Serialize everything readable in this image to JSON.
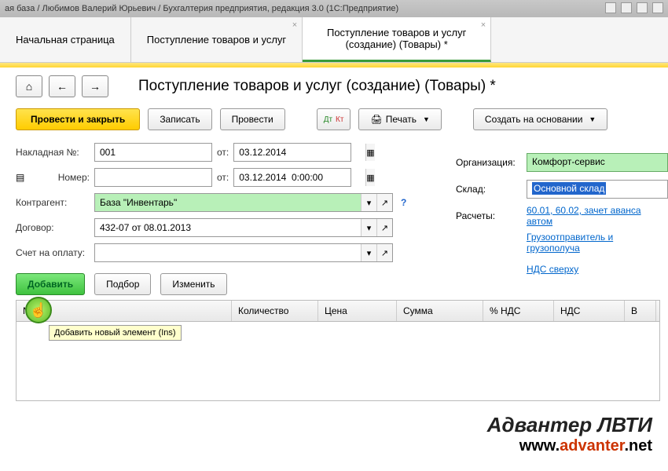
{
  "titlebar": "ая база / Любимов Валерий Юрьевич / Бухгалтерия предприятия, редакция 3.0  (1С:Предприятие)",
  "tabs": [
    {
      "label": "Начальная страница",
      "closable": false
    },
    {
      "label": "Поступление товаров и услуг",
      "closable": true
    },
    {
      "label": "Поступление товаров и услуг (создание) (Товары) *",
      "closable": true
    }
  ],
  "pageTitle": "Поступление товаров и услуг (создание) (Товары) *",
  "actions": {
    "postClose": "Провести и закрыть",
    "save": "Записать",
    "post": "Провести",
    "print": "Печать",
    "createBased": "Создать на основании"
  },
  "form": {
    "invoiceNoLabel": "Накладная №:",
    "invoiceNo": "001",
    "fromLabel": "от:",
    "invoiceDate": "03.12.2014",
    "numberLabel": "Номер:",
    "number": "",
    "numberDate": "03.12.2014  0:00:00",
    "counterpartyLabel": "Контрагент:",
    "counterparty": "База \"Инвентарь\"",
    "contractLabel": "Договор:",
    "contract": "432-07 от 08.01.2013",
    "invoicePayLabel": "Счет на оплату:",
    "invoicePay": ""
  },
  "right": {
    "orgLabel": "Организация:",
    "org": "Комфорт-сервис",
    "warehouseLabel": "Склад:",
    "warehouse": "Основной склад",
    "settlementsLabel": "Расчеты:",
    "settlements": "60.01, 60.02, зачет аванса автом",
    "shipperLink": "Грузоотправитель и грузополуча",
    "vatLink": "НДС сверху"
  },
  "tableBtns": {
    "add": "Добавить",
    "pick": "Подбор",
    "edit": "Изменить"
  },
  "tooltip": "Добавить новый элемент (Ins)",
  "columns": [
    "N",
    "",
    "Количество",
    "Цена",
    "Сумма",
    "% НДС",
    "НДС",
    "В"
  ],
  "watermark": {
    "line1": "Адвантер ЛВТИ",
    "line2a": "www.",
    "line2b": "advanter",
    "line2c": ".net"
  }
}
